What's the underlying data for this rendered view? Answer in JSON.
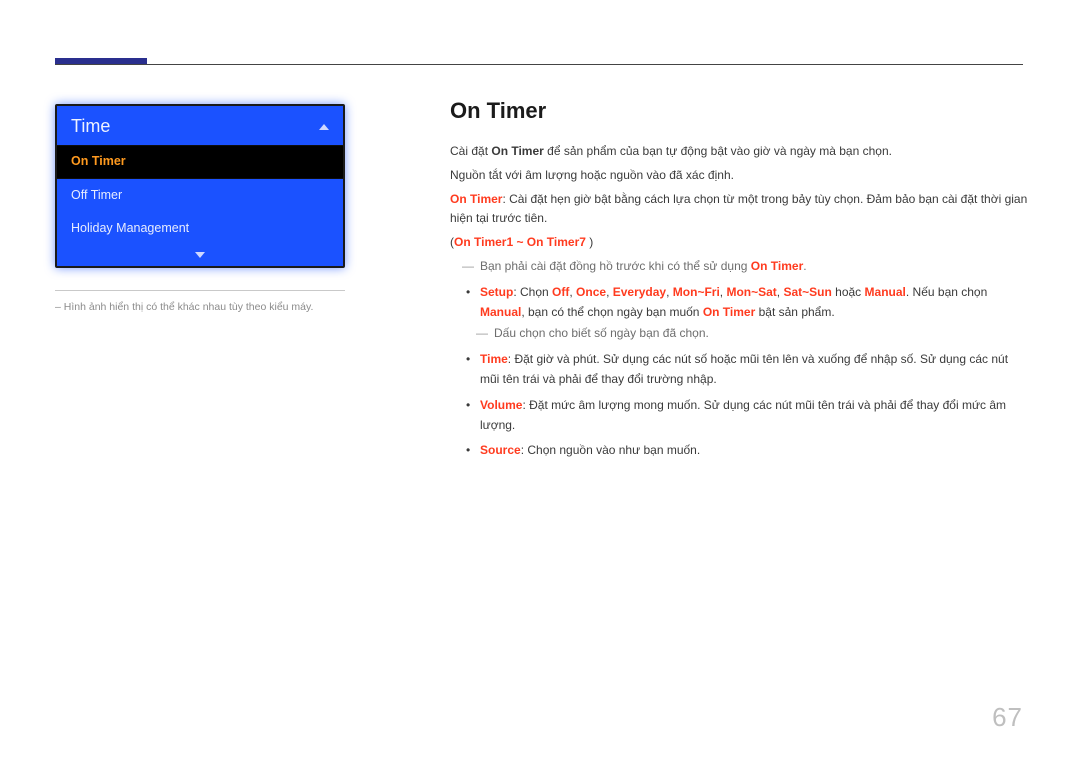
{
  "page_number": "67",
  "menu": {
    "title": "Time",
    "items": [
      "On Timer",
      "Off Timer",
      "Holiday Management"
    ],
    "selected_index": 0
  },
  "left_caption": "Hình ảnh hiển thị có thể khác nhau tùy theo kiểu máy.",
  "section_title": "On Timer",
  "intro": {
    "line1_pre": "Cài đặt ",
    "line1_strong": "On Timer",
    "line1_post": " để sản phẩm của bạn tự động bật vào giờ và ngày mà bạn chọn.",
    "line2": "Nguồn tắt với âm lượng hoặc nguồn vào đã xác định.",
    "line3_strong": "On Timer",
    "line3_post": ": Cài đặt hẹn giờ bật bằng cách lựa chọn từ một trong bảy tùy chọn. Đảm bảo bạn cài đặt thời gian hiện tại trước tiên.",
    "paren_pre": "(",
    "paren_strong": "On Timer1 ~ On Timer7",
    "paren_post": " )"
  },
  "note_clock_pre": "Bạn phải cài đặt đồng hồ trước khi có thể sử dụng ",
  "note_clock_strong": "On Timer",
  "note_clock_post": ".",
  "setup_bullet": {
    "label": "Setup",
    "sep": ": Chọn ",
    "opts": [
      "Off",
      "Once",
      "Everyday",
      "Mon~Fri",
      "Mon~Sat",
      "Sat~Sun"
    ],
    "or_word": " hoặc ",
    "manual": "Manual",
    "after": ". Nếu bạn chọn ",
    "manual2": "Manual",
    "tail_pre": ", bạn có thể chọn ngày bạn muốn ",
    "tail_strong": "On Timer",
    "tail_post": " bật sản phẩm."
  },
  "note_marks": "Dấu chọn cho biết số ngày bạn đã chọn.",
  "time_bullet": {
    "label": "Time",
    "text": ": Đặt giờ và phút. Sử dụng các nút số hoặc mũi tên lên và xuống để nhập số. Sử dụng các nút mũi tên trái và phải để thay đổi trường nhập."
  },
  "volume_bullet": {
    "label": "Volume",
    "text": ": Đặt mức âm lượng mong muốn. Sử dụng các nút mũi tên trái và phải để thay đổi mức âm lượng."
  },
  "source_bullet": {
    "label": "Source",
    "text": ": Chọn nguồn vào như bạn muốn."
  }
}
